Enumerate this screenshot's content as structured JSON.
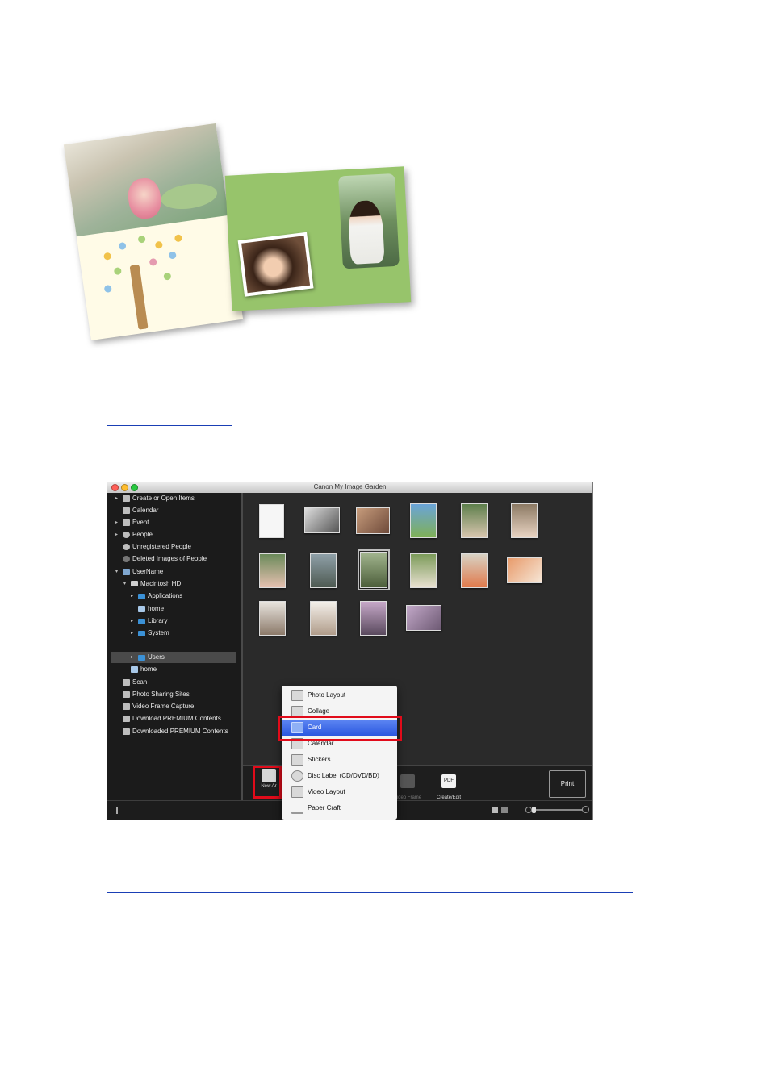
{
  "window": {
    "title": "Canon My Image Garden"
  },
  "sidebar": {
    "items": [
      {
        "label": "Create or Open Items",
        "arrow": "▸",
        "icon": "create-open-icon"
      },
      {
        "label": "Calendar",
        "arrow": "",
        "icon": "calendar-icon"
      },
      {
        "label": "Event",
        "arrow": "▸",
        "icon": "event-icon"
      },
      {
        "label": "People",
        "arrow": "▸",
        "icon": "people-icon"
      },
      {
        "label": "Unregistered People",
        "arrow": "",
        "icon": "unregistered-people-icon"
      },
      {
        "label": "Deleted Images of People",
        "arrow": "",
        "icon": "deleted-people-icon"
      },
      {
        "label": "UserName",
        "arrow": "▾",
        "icon": "computer-icon"
      },
      {
        "label": "Macintosh HD",
        "arrow": "▾",
        "icon": "drive-icon"
      },
      {
        "label": "Applications",
        "arrow": "▸",
        "icon": "folder-icon"
      },
      {
        "label": "home",
        "arrow": "",
        "icon": "home-folder-icon"
      },
      {
        "label": "Library",
        "arrow": "▸",
        "icon": "folder-icon"
      },
      {
        "label": "System",
        "arrow": "▸",
        "icon": "folder-icon"
      },
      {
        "label": "Users",
        "arrow": "▸",
        "icon": "folder-icon"
      },
      {
        "label": "home",
        "arrow": "",
        "icon": "home-folder-icon"
      },
      {
        "label": "Scan",
        "arrow": "",
        "icon": "scan-icon"
      },
      {
        "label": "Photo Sharing Sites",
        "arrow": "",
        "icon": "photo-sharing-icon"
      },
      {
        "label": "Video Frame Capture",
        "arrow": "",
        "icon": "video-frame-icon"
      },
      {
        "label": "Download PREMIUM Contents",
        "arrow": "",
        "icon": "download-icon"
      },
      {
        "label": "Downloaded PREMIUM Contents",
        "arrow": "",
        "icon": "downloaded-icon"
      }
    ]
  },
  "toolbar": {
    "new_art_label": "New Ar",
    "video_label": "Video Frame\nCapture",
    "pdf_icon_text": "PDF",
    "pdf_label": "Create/Edit\nPDF File",
    "print_label": "Print"
  },
  "menu": {
    "items": [
      {
        "label": "Photo Layout",
        "icon": "photo-layout-icon"
      },
      {
        "label": "Collage",
        "icon": "collage-icon"
      },
      {
        "label": "Card",
        "icon": "card-icon"
      },
      {
        "label": "Calendar",
        "icon": "calendar-icon"
      },
      {
        "label": "Stickers",
        "icon": "stickers-icon"
      },
      {
        "label": "Disc Label (CD/DVD/BD)",
        "icon": "disc-icon"
      },
      {
        "label": "Video Layout",
        "icon": "video-layout-icon"
      },
      {
        "label": "Paper Craft",
        "icon": "paper-craft-icon"
      }
    ],
    "active_item": "Card"
  },
  "colors": {
    "highlight_red": "#e10b1a",
    "menu_active_blue": "#3a66e8",
    "link_blue": "#1a3fb5"
  }
}
